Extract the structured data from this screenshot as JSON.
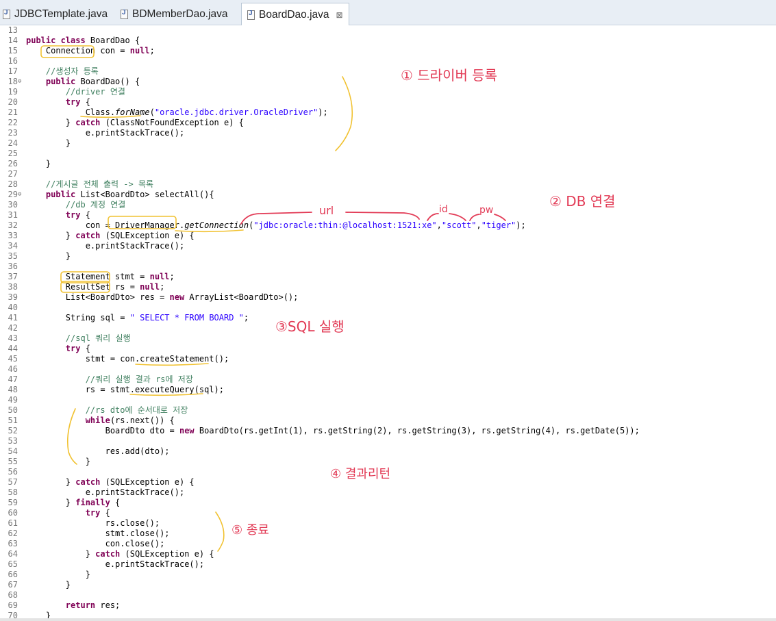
{
  "tabs": [
    {
      "label": "JDBCTemplate.java",
      "active": false
    },
    {
      "label": "BDMemberDao.java",
      "active": false
    },
    {
      "label": "BoardDao.java",
      "active": true
    }
  ],
  "tab_close_glyph": "⊠",
  "code_lines": [
    {
      "n": "13",
      "t": [
        {
          "s": ""
        }
      ]
    },
    {
      "n": "14",
      "t": [
        {
          "s": "public class ",
          "c": "kw"
        },
        {
          "s": "BoardDao {"
        }
      ]
    },
    {
      "n": "15",
      "t": [
        {
          "s": "    Connection con = "
        },
        {
          "s": "null",
          "c": "kw"
        },
        {
          "s": ";"
        }
      ]
    },
    {
      "n": "16",
      "t": [
        {
          "s": ""
        }
      ]
    },
    {
      "n": "17",
      "t": [
        {
          "s": "    "
        },
        {
          "s": "//생성자 등록",
          "c": "cm"
        }
      ]
    },
    {
      "n": "18",
      "fold": true,
      "t": [
        {
          "s": "    "
        },
        {
          "s": "public ",
          "c": "kw"
        },
        {
          "s": "BoardDao() {"
        }
      ]
    },
    {
      "n": "19",
      "t": [
        {
          "s": "        "
        },
        {
          "s": "//driver 연결",
          "c": "cm"
        }
      ]
    },
    {
      "n": "20",
      "t": [
        {
          "s": "        "
        },
        {
          "s": "try",
          "c": "kw"
        },
        {
          "s": " {"
        }
      ]
    },
    {
      "n": "21",
      "t": [
        {
          "s": "            Class."
        },
        {
          "s": "forName",
          "c": "it"
        },
        {
          "s": "("
        },
        {
          "s": "\"oracle.jdbc.driver.OracleDriver\"",
          "c": "str"
        },
        {
          "s": ");"
        }
      ]
    },
    {
      "n": "22",
      "t": [
        {
          "s": "        } "
        },
        {
          "s": "catch",
          "c": "kw"
        },
        {
          "s": " (ClassNotFoundException e) {"
        }
      ]
    },
    {
      "n": "23",
      "t": [
        {
          "s": "            e.printStackTrace();"
        }
      ]
    },
    {
      "n": "24",
      "t": [
        {
          "s": "        }"
        }
      ]
    },
    {
      "n": "25",
      "t": [
        {
          "s": ""
        }
      ]
    },
    {
      "n": "26",
      "t": [
        {
          "s": "    }"
        }
      ]
    },
    {
      "n": "27",
      "t": [
        {
          "s": ""
        }
      ]
    },
    {
      "n": "28",
      "t": [
        {
          "s": "    "
        },
        {
          "s": "//게시글 전체 출력 -> 목록",
          "c": "cm"
        }
      ]
    },
    {
      "n": "29",
      "fold": true,
      "t": [
        {
          "s": "    "
        },
        {
          "s": "public ",
          "c": "kw"
        },
        {
          "s": "List<BoardDto> selectAll(){"
        }
      ]
    },
    {
      "n": "30",
      "t": [
        {
          "s": "        "
        },
        {
          "s": "//db 계정 연결",
          "c": "cm"
        }
      ]
    },
    {
      "n": "31",
      "t": [
        {
          "s": "        "
        },
        {
          "s": "try",
          "c": "kw"
        },
        {
          "s": " {"
        }
      ]
    },
    {
      "n": "32",
      "t": [
        {
          "s": "            con = DriverManager."
        },
        {
          "s": "getConnection",
          "c": "it"
        },
        {
          "s": "("
        },
        {
          "s": "\"jdbc:oracle:thin:@localhost:1521:xe\"",
          "c": "str"
        },
        {
          "s": ","
        },
        {
          "s": "\"scott\"",
          "c": "str"
        },
        {
          "s": ","
        },
        {
          "s": "\"tiger\"",
          "c": "str"
        },
        {
          "s": ");"
        }
      ]
    },
    {
      "n": "33",
      "t": [
        {
          "s": "        } "
        },
        {
          "s": "catch",
          "c": "kw"
        },
        {
          "s": " (SQLException e) {"
        }
      ]
    },
    {
      "n": "34",
      "t": [
        {
          "s": "            e.printStackTrace();"
        }
      ]
    },
    {
      "n": "35",
      "t": [
        {
          "s": "        }"
        }
      ]
    },
    {
      "n": "36",
      "t": [
        {
          "s": ""
        }
      ]
    },
    {
      "n": "37",
      "t": [
        {
          "s": "        Statement stmt = "
        },
        {
          "s": "null",
          "c": "kw"
        },
        {
          "s": ";"
        }
      ]
    },
    {
      "n": "38",
      "t": [
        {
          "s": "        ResultSet rs = "
        },
        {
          "s": "null",
          "c": "kw"
        },
        {
          "s": ";"
        }
      ]
    },
    {
      "n": "39",
      "t": [
        {
          "s": "        List<BoardDto> res = "
        },
        {
          "s": "new",
          "c": "kw"
        },
        {
          "s": " ArrayList<BoardDto>();"
        }
      ]
    },
    {
      "n": "40",
      "t": [
        {
          "s": ""
        }
      ]
    },
    {
      "n": "41",
      "t": [
        {
          "s": "        String sql = "
        },
        {
          "s": "\" SELECT * FROM BOARD \"",
          "c": "str"
        },
        {
          "s": ";"
        }
      ]
    },
    {
      "n": "42",
      "t": [
        {
          "s": ""
        }
      ]
    },
    {
      "n": "43",
      "t": [
        {
          "s": "        "
        },
        {
          "s": "//sql 쿼리 실행",
          "c": "cm"
        }
      ]
    },
    {
      "n": "44",
      "t": [
        {
          "s": "        "
        },
        {
          "s": "try",
          "c": "kw"
        },
        {
          "s": " {"
        }
      ]
    },
    {
      "n": "45",
      "t": [
        {
          "s": "            stmt = con.createStatement();"
        }
      ]
    },
    {
      "n": "46",
      "t": [
        {
          "s": ""
        }
      ]
    },
    {
      "n": "47",
      "t": [
        {
          "s": "            "
        },
        {
          "s": "//쿼리 실행 결과 rs에 저장",
          "c": "cm"
        }
      ]
    },
    {
      "n": "48",
      "t": [
        {
          "s": "            rs = stmt.executeQuery(sql);"
        }
      ]
    },
    {
      "n": "49",
      "t": [
        {
          "s": ""
        }
      ]
    },
    {
      "n": "50",
      "t": [
        {
          "s": "            "
        },
        {
          "s": "//rs dto에 순서대로 저장",
          "c": "cm"
        }
      ]
    },
    {
      "n": "51",
      "t": [
        {
          "s": "            "
        },
        {
          "s": "while",
          "c": "kw"
        },
        {
          "s": "(rs.next()) {"
        }
      ]
    },
    {
      "n": "52",
      "t": [
        {
          "s": "                BoardDto dto = "
        },
        {
          "s": "new",
          "c": "kw"
        },
        {
          "s": " BoardDto(rs.getInt(1), rs.getString(2), rs.getString(3), rs.getString(4), rs.getDate(5));"
        }
      ]
    },
    {
      "n": "53",
      "t": [
        {
          "s": ""
        }
      ]
    },
    {
      "n": "54",
      "t": [
        {
          "s": "                res.add(dto);"
        }
      ]
    },
    {
      "n": "55",
      "t": [
        {
          "s": "            }"
        }
      ]
    },
    {
      "n": "56",
      "t": [
        {
          "s": ""
        }
      ]
    },
    {
      "n": "57",
      "t": [
        {
          "s": "        } "
        },
        {
          "s": "catch",
          "c": "kw"
        },
        {
          "s": " (SQLException e) {"
        }
      ]
    },
    {
      "n": "58",
      "t": [
        {
          "s": "            e.printStackTrace();"
        }
      ]
    },
    {
      "n": "59",
      "t": [
        {
          "s": "        } "
        },
        {
          "s": "finally",
          "c": "kw"
        },
        {
          "s": " {"
        }
      ]
    },
    {
      "n": "60",
      "t": [
        {
          "s": "            "
        },
        {
          "s": "try",
          "c": "kw"
        },
        {
          "s": " {"
        }
      ]
    },
    {
      "n": "61",
      "t": [
        {
          "s": "                rs.close();"
        }
      ]
    },
    {
      "n": "62",
      "t": [
        {
          "s": "                stmt.close();"
        }
      ]
    },
    {
      "n": "63",
      "t": [
        {
          "s": "                con.close();"
        }
      ]
    },
    {
      "n": "64",
      "t": [
        {
          "s": "            } "
        },
        {
          "s": "catch",
          "c": "kw"
        },
        {
          "s": " (SQLException e) {"
        }
      ]
    },
    {
      "n": "65",
      "t": [
        {
          "s": "                e.printStackTrace();"
        }
      ]
    },
    {
      "n": "66",
      "t": [
        {
          "s": "            }"
        }
      ]
    },
    {
      "n": "67",
      "t": [
        {
          "s": "        }"
        }
      ]
    },
    {
      "n": "68",
      "t": [
        {
          "s": ""
        }
      ]
    },
    {
      "n": "69",
      "t": [
        {
          "s": "        "
        },
        {
          "s": "return",
          "c": "kw"
        },
        {
          "s": " res;"
        }
      ]
    },
    {
      "n": "70",
      "t": [
        {
          "s": "    }"
        }
      ]
    }
  ],
  "annotations": {
    "step1": "① 드라이버 등록",
    "step2": "② DB 연결",
    "step3": "③SQL 실행",
    "step4": "④ 결과리턴",
    "step5": "⑤ 종료",
    "url": "url",
    "id": "id",
    "pw": "pw"
  },
  "colors": {
    "keyword": "#7f0055",
    "comment": "#3f7f5f",
    "string": "#2a00ff",
    "line_number": "#787878",
    "annotation_red": "#e23a55",
    "annotation_yellow": "#f1c232"
  }
}
